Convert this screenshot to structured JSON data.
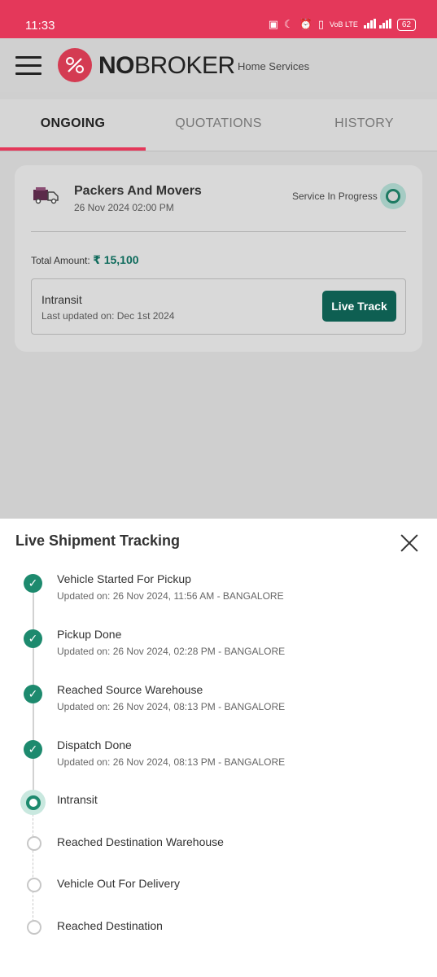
{
  "status_bar": {
    "time": "11:33",
    "battery": "62",
    "network": "VoB LTE"
  },
  "header": {
    "logo_bold": "NO",
    "logo_light": "BROKER",
    "subtitle": "Home Services"
  },
  "tabs": [
    {
      "label": "ONGOING",
      "active": true
    },
    {
      "label": "QUOTATIONS",
      "active": false
    },
    {
      "label": "HISTORY",
      "active": false
    }
  ],
  "booking": {
    "service": "Packers And Movers",
    "date": "26 Nov 2024 02:00 PM",
    "status": "Service In Progress",
    "total_label": "Total Amount:",
    "total_amount": "₹ 15,100",
    "tracking_status": "Intransit",
    "last_updated": "Last updated on: Dec 1st 2024",
    "live_track_label": "Live Track"
  },
  "tracking": {
    "title": "Live Shipment Tracking",
    "steps": [
      {
        "label": "Vehicle Started For Pickup",
        "updated": "Updated on: 26 Nov 2024, 11:56 AM - BANGALORE",
        "state": "done"
      },
      {
        "label": "Pickup Done",
        "updated": "Updated on: 26 Nov 2024, 02:28 PM - BANGALORE",
        "state": "done"
      },
      {
        "label": "Reached Source Warehouse",
        "updated": "Updated on: 26 Nov 2024, 08:13 PM - BANGALORE",
        "state": "done"
      },
      {
        "label": "Dispatch Done",
        "updated": "Updated on: 26 Nov 2024, 08:13 PM - BANGALORE",
        "state": "done"
      },
      {
        "label": "Intransit",
        "updated": "",
        "state": "current"
      },
      {
        "label": "Reached Destination Warehouse",
        "updated": "",
        "state": "pending"
      },
      {
        "label": "Vehicle Out For Delivery",
        "updated": "",
        "state": "pending"
      },
      {
        "label": "Reached Destination",
        "updated": "",
        "state": "pending"
      }
    ]
  },
  "colors": {
    "brand": "#e4385a",
    "accent": "#0e5f52",
    "done": "#1d8a6e"
  }
}
